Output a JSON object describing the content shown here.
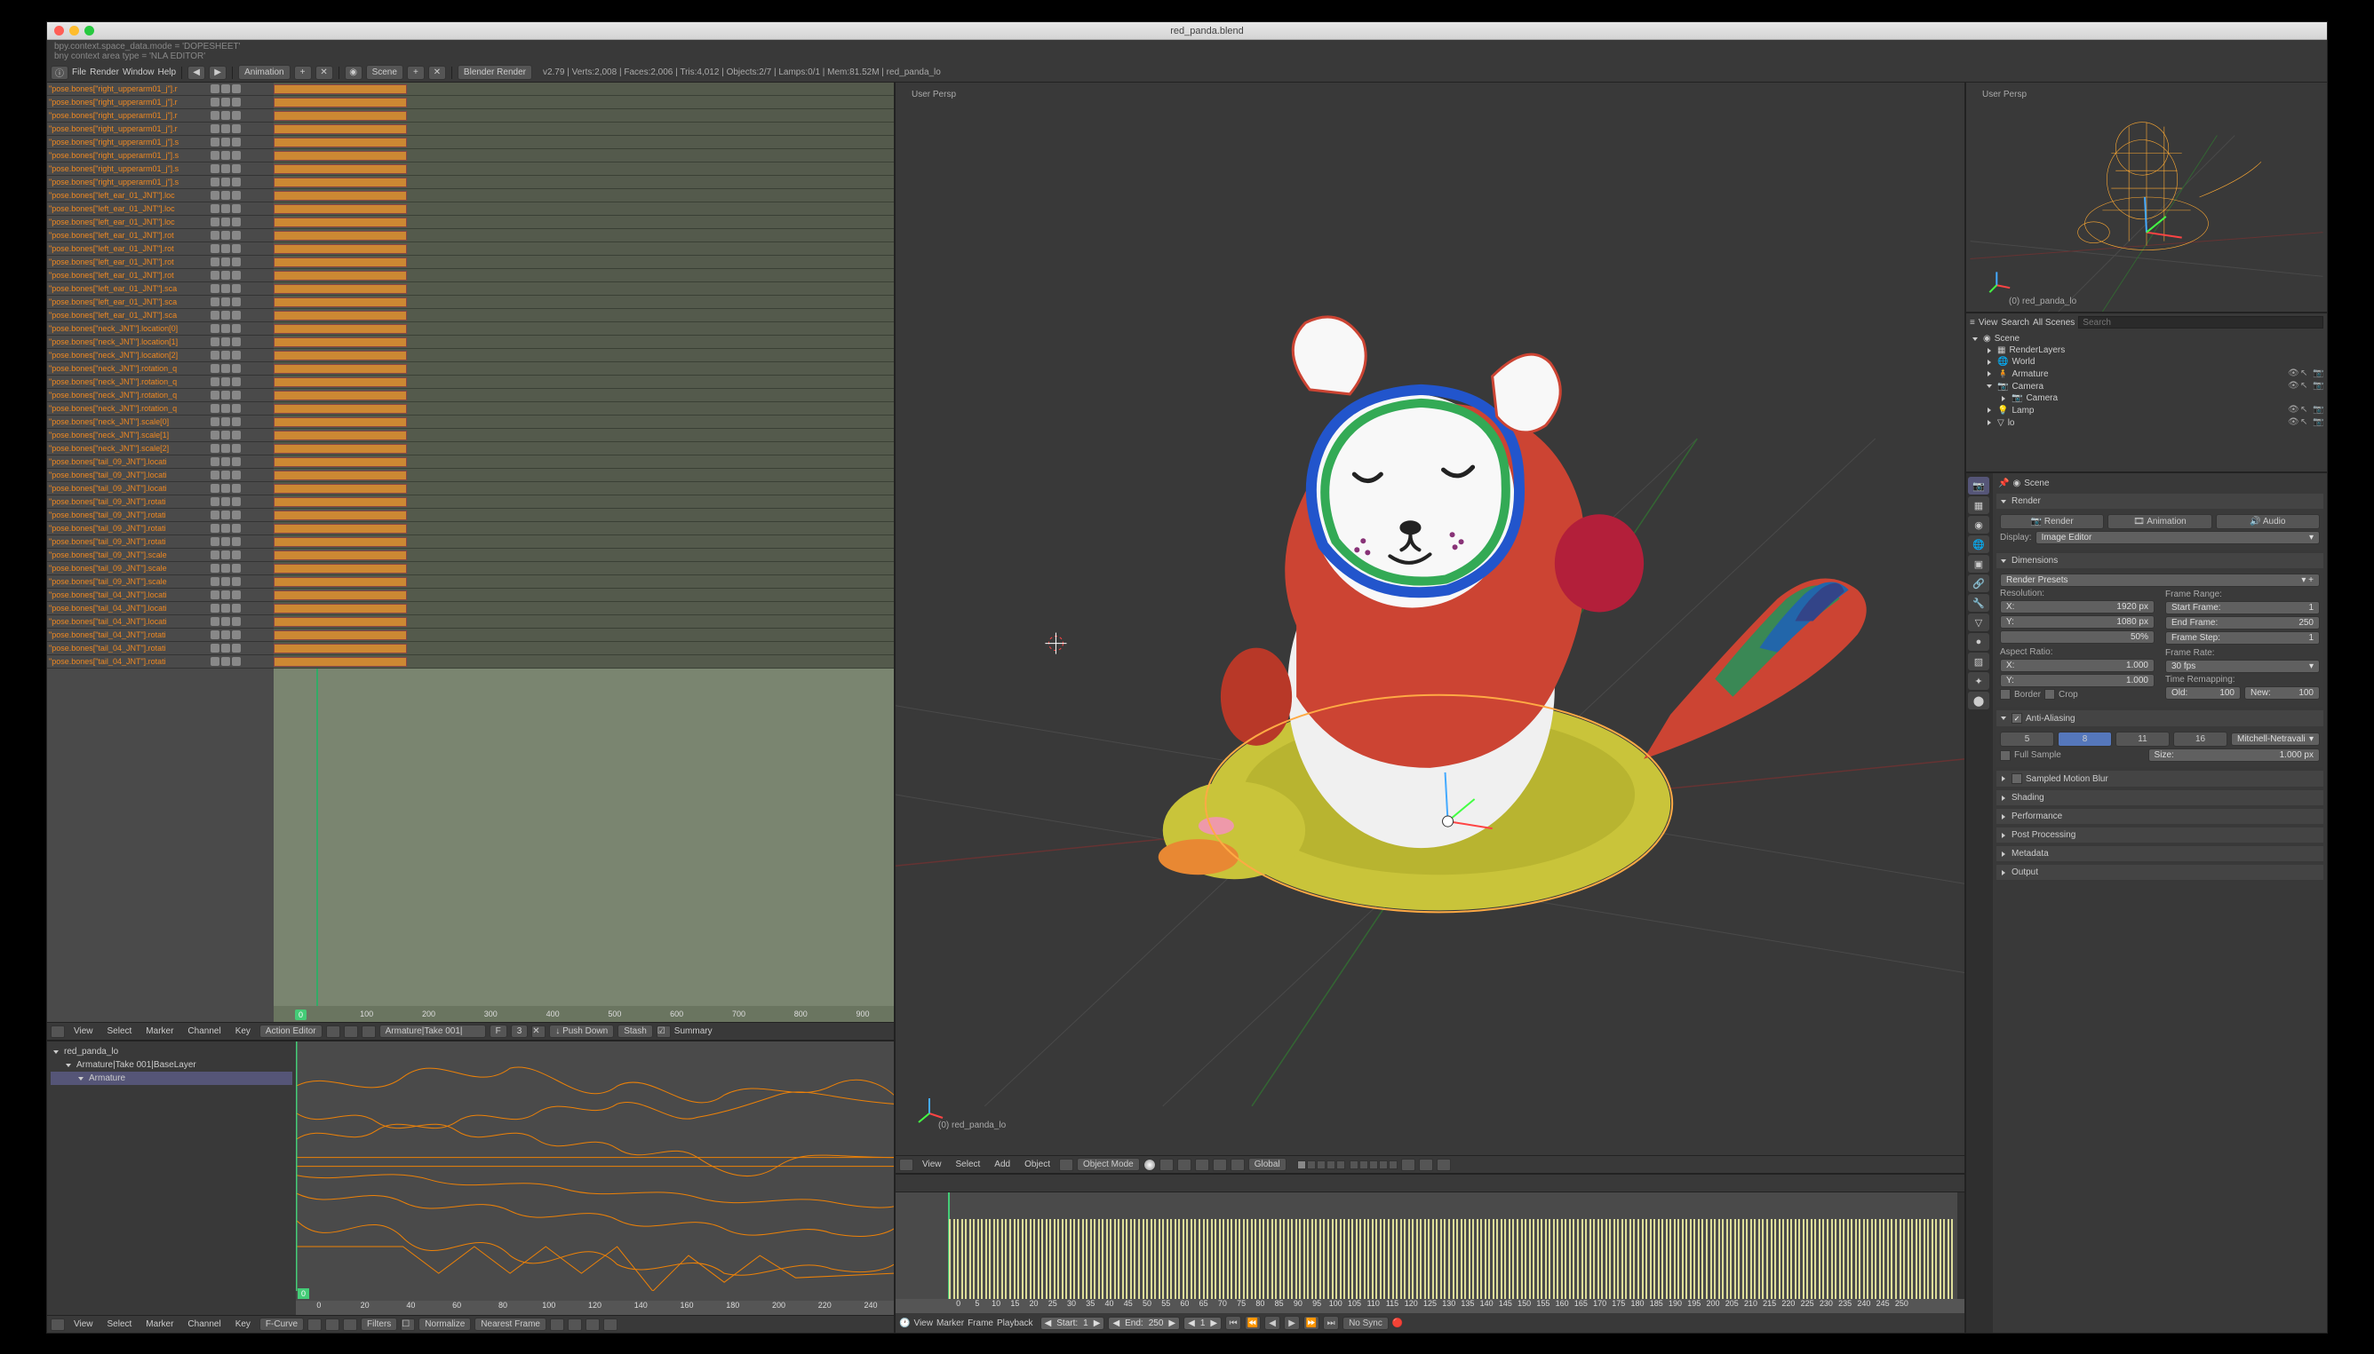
{
  "window_title": "red_panda.blend",
  "console": {
    "line1": "bpy.context.space_data.mode = 'DOPESHEET'",
    "line2": "bny context area type = 'NLA EDITOR'"
  },
  "info_bar": {
    "menus": [
      "File",
      "Render",
      "Window",
      "Help"
    ],
    "layout": "Animation",
    "scene": "Scene",
    "engine": "Blender Render",
    "stats": "v2.79 | Verts:2,008 | Faces:2,006 | Tris:4,012 | Objects:2/7 | Lamps:0/1 | Mem:81.52M | red_panda_lo"
  },
  "dopesheet": {
    "channels": [
      "\"pose.bones[\"right_upperarm01_j\"].r",
      "\"pose.bones[\"right_upperarm01_j\"].r",
      "\"pose.bones[\"right_upperarm01_j\"].r",
      "\"pose.bones[\"right_upperarm01_j\"].r",
      "\"pose.bones[\"right_upperarm01_j\"].s",
      "\"pose.bones[\"right_upperarm01_j\"].s",
      "\"pose.bones[\"right_upperarm01_j\"].s",
      "\"pose.bones[\"right_upperarm01_j\"].s",
      "\"pose.bones[\"left_ear_01_JNT\"].loc",
      "\"pose.bones[\"left_ear_01_JNT\"].loc",
      "\"pose.bones[\"left_ear_01_JNT\"].loc",
      "\"pose.bones[\"left_ear_01_JNT\"].rot",
      "\"pose.bones[\"left_ear_01_JNT\"].rot",
      "\"pose.bones[\"left_ear_01_JNT\"].rot",
      "\"pose.bones[\"left_ear_01_JNT\"].rot",
      "\"pose.bones[\"left_ear_01_JNT\"].sca",
      "\"pose.bones[\"left_ear_01_JNT\"].sca",
      "\"pose.bones[\"left_ear_01_JNT\"].sca",
      "\"pose.bones[\"neck_JNT\"].location[0]",
      "\"pose.bones[\"neck_JNT\"].location[1]",
      "\"pose.bones[\"neck_JNT\"].location[2]",
      "\"pose.bones[\"neck_JNT\"].rotation_q",
      "\"pose.bones[\"neck_JNT\"].rotation_q",
      "\"pose.bones[\"neck_JNT\"].rotation_q",
      "\"pose.bones[\"neck_JNT\"].rotation_q",
      "\"pose.bones[\"neck_JNT\"].scale[0]",
      "\"pose.bones[\"neck_JNT\"].scale[1]",
      "\"pose.bones[\"neck_JNT\"].scale[2]",
      "\"pose.bones[\"tail_09_JNT\"].locati",
      "\"pose.bones[\"tail_09_JNT\"].locati",
      "\"pose.bones[\"tail_09_JNT\"].locati",
      "\"pose.bones[\"tail_09_JNT\"].rotati",
      "\"pose.bones[\"tail_09_JNT\"].rotati",
      "\"pose.bones[\"tail_09_JNT\"].rotati",
      "\"pose.bones[\"tail_09_JNT\"].rotati",
      "\"pose.bones[\"tail_09_JNT\"].scale",
      "\"pose.bones[\"tail_09_JNT\"].scale",
      "\"pose.bones[\"tail_09_JNT\"].scale",
      "\"pose.bones[\"tail_04_JNT\"].locati",
      "\"pose.bones[\"tail_04_JNT\"].locati",
      "\"pose.bones[\"tail_04_JNT\"].locati",
      "\"pose.bones[\"tail_04_JNT\"].rotati",
      "\"pose.bones[\"tail_04_JNT\"].rotati",
      "\"pose.bones[\"tail_04_JNT\"].rotati"
    ],
    "ruler": [
      "0",
      "100",
      "200",
      "300",
      "400",
      "500",
      "600",
      "700",
      "800",
      "900"
    ],
    "frame": "0",
    "header": {
      "menus": [
        "View",
        "Select",
        "Marker",
        "Channel",
        "Key"
      ],
      "mode": "Action Editor",
      "action": "Armature|Take 001|",
      "fake_user": "F",
      "users": "3",
      "summary": "Summary",
      "btns": [
        "Push Down",
        "Stash"
      ]
    }
  },
  "graph": {
    "tree": [
      {
        "label": "red_panda_lo",
        "indent": 0
      },
      {
        "label": "Armature|Take 001|BaseLayer",
        "indent": 1
      },
      {
        "label": "Armature",
        "indent": 2,
        "sel": true
      }
    ],
    "ruler": [
      "0",
      "20",
      "40",
      "60",
      "80",
      "100",
      "120",
      "140",
      "160",
      "180",
      "200",
      "220",
      "240"
    ],
    "frame": "0",
    "header": {
      "menus": [
        "View",
        "Select",
        "Marker",
        "Channel",
        "Key"
      ],
      "mode": "F-Curve",
      "filters": "Filters",
      "normalize": "Normalize",
      "snap": "Nearest Frame"
    }
  },
  "viewport": {
    "persp": "User Persp",
    "object": "(0) red_panda_lo",
    "header": {
      "menus": [
        "View",
        "Select",
        "Add",
        "Object"
      ],
      "mode": "Object Mode",
      "orientation": "Global"
    }
  },
  "mini_viewport": {
    "persp": "User Persp",
    "object": "(0) red_panda_lo"
  },
  "timeline": {
    "ruler": [
      "0",
      "5",
      "10",
      "15",
      "20",
      "25",
      "30",
      "35",
      "40",
      "45",
      "50",
      "55",
      "60",
      "65",
      "70",
      "75",
      "80",
      "85",
      "90",
      "95",
      "100",
      "105",
      "110",
      "115",
      "120",
      "125",
      "130",
      "135",
      "140",
      "145",
      "150",
      "155",
      "160",
      "165",
      "170",
      "175",
      "180",
      "185",
      "190",
      "195",
      "200",
      "205",
      "210",
      "215",
      "220",
      "225",
      "230",
      "235",
      "240",
      "245",
      "250"
    ],
    "header": {
      "menus": [
        "View",
        "Marker",
        "Frame",
        "Playback"
      ],
      "start_label": "Start:",
      "start": "1",
      "end_label": "End:",
      "end": "250",
      "frame": "1",
      "sync": "No Sync"
    }
  },
  "outliner": {
    "header": {
      "view": "View",
      "search": "Search",
      "filter": "All Scenes"
    },
    "tree": [
      {
        "label": "Scene",
        "indent": 0,
        "icon": "scene",
        "open": true
      },
      {
        "label": "RenderLayers",
        "indent": 1,
        "icon": "layers"
      },
      {
        "label": "World",
        "indent": 1,
        "icon": "world"
      },
      {
        "label": "Armature",
        "indent": 1,
        "icon": "armature",
        "vis": true
      },
      {
        "label": "Camera",
        "indent": 1,
        "icon": "camera",
        "open": true,
        "vis": true
      },
      {
        "label": "Camera",
        "indent": 2,
        "icon": "camera-data"
      },
      {
        "label": "Lamp",
        "indent": 1,
        "icon": "lamp",
        "vis": true
      },
      {
        "label": "lo",
        "indent": 1,
        "icon": "mesh",
        "vis": true
      }
    ]
  },
  "properties": {
    "crumb": "Scene",
    "panels": {
      "render": {
        "title": "Render",
        "buttons": [
          "Render",
          "Animation",
          "Audio"
        ],
        "display_label": "Display:",
        "display": "Image Editor"
      },
      "dimensions": {
        "title": "Dimensions",
        "presets": "Render Presets",
        "resolution_label": "Resolution:",
        "x_label": "X:",
        "x": "1920 px",
        "y_label": "Y:",
        "y": "1080 px",
        "pct": "50%",
        "aspect_label": "Aspect Ratio:",
        "ax_label": "X:",
        "ax": "1.000",
        "ay_label": "Y:",
        "ay": "1.000",
        "border": "Border",
        "crop": "Crop",
        "frame_range_label": "Frame Range:",
        "start_label": "Start Frame:",
        "start": "1",
        "end_label": "End Frame:",
        "end": "250",
        "step_label": "Frame Step:",
        "step": "1",
        "rate_label": "Frame Rate:",
        "fps": "30 fps",
        "remap_label": "Time Remapping:",
        "old_label": "Old:",
        "old": "100",
        "new_label": "New:",
        "new": "100"
      },
      "aa": {
        "title": "Anti-Aliasing",
        "samples": [
          "5",
          "8",
          "11",
          "16"
        ],
        "active": "8",
        "filter": "Mitchell-Netravali",
        "full": "Full Sample",
        "size_label": "Size:",
        "size": "1.000 px"
      },
      "collapsed": [
        "Sampled Motion Blur",
        "Shading",
        "Performance",
        "Post Processing",
        "Metadata",
        "Output"
      ]
    }
  }
}
